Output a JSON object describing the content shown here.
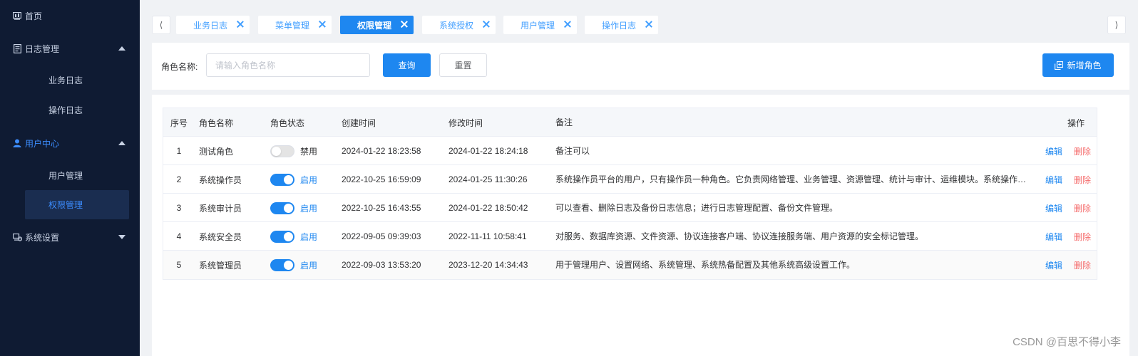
{
  "sidebar": {
    "home": {
      "label": "首页",
      "icon": "dashboard-icon"
    },
    "log_mgmt": {
      "label": "日志管理",
      "icon": "document-icon",
      "expanded": true
    },
    "log_sub": [
      "业务日志",
      "操作日志"
    ],
    "user_center": {
      "label": "用户中心",
      "icon": "user-icon",
      "expanded": true
    },
    "user_sub": [
      "用户管理",
      "权限管理"
    ],
    "user_sub_active": "权限管理",
    "sys_settings": {
      "label": "系统设置",
      "icon": "settings-icon",
      "expanded": false
    }
  },
  "tabs": {
    "prev": "⟨",
    "next": "⟩",
    "items": [
      {
        "label": "业务日志",
        "active": false
      },
      {
        "label": "菜单管理",
        "active": false
      },
      {
        "label": "权限管理",
        "active": true
      },
      {
        "label": "系统授权",
        "active": false
      },
      {
        "label": "用户管理",
        "active": false
      },
      {
        "label": "操作日志",
        "active": false
      }
    ]
  },
  "search": {
    "label": "角色名称:",
    "placeholder": "请输入角色名称",
    "value": "",
    "query_button": "查询",
    "reset_button": "重置",
    "add_button": "新增角色"
  },
  "table": {
    "headers": {
      "index": "序号",
      "name": "角色名称",
      "status": "角色状态",
      "created": "创建时间",
      "modified": "修改时间",
      "remark": "备注",
      "ops": "操作"
    },
    "rows": [
      {
        "index": "1",
        "name": "测试角色",
        "enabled": false,
        "status": "禁用",
        "created": "2024-01-22 18:23:58",
        "modified": "2024-01-22 18:24:18",
        "remark": "备注可以"
      },
      {
        "index": "2",
        "name": "系统操作员",
        "enabled": true,
        "status": "启用",
        "created": "2022-10-25 16:59:09",
        "modified": "2024-01-25 11:30:26",
        "remark": "系统操作员平台的用户，只有操作员一种角色。它负责网络管理、业务管理、资源管理、统计与审计、运维模块。系统操作员平..."
      },
      {
        "index": "3",
        "name": "系统审计员",
        "enabled": true,
        "status": "启用",
        "created": "2022-10-25 16:43:55",
        "modified": "2024-01-22 18:50:42",
        "remark": "可以查看、删除日志及备份日志信息；进行日志管理配置、备份文件管理。"
      },
      {
        "index": "4",
        "name": "系统安全员",
        "enabled": true,
        "status": "启用",
        "created": "2022-09-05 09:39:03",
        "modified": "2022-11-11 10:58:41",
        "remark": "对服务、数据库资源、文件资源、协议连接客户端、协议连接服务端、用户资源的安全标记管理。"
      },
      {
        "index": "5",
        "name": "系统管理员",
        "enabled": true,
        "status": "启用",
        "created": "2022-09-03 13:53:20",
        "modified": "2023-12-20 14:34:43",
        "remark": "用于管理用户、设置网络、系统管理、系统热备配置及其他系统高级设置工作。"
      }
    ],
    "edit_label": "编辑",
    "delete_label": "删除"
  },
  "watermark": "CSDN @百思不得小李",
  "colors": {
    "sidebar_bg": "#0f1b33",
    "primary": "#1e87f0",
    "danger": "#f56c6c"
  }
}
